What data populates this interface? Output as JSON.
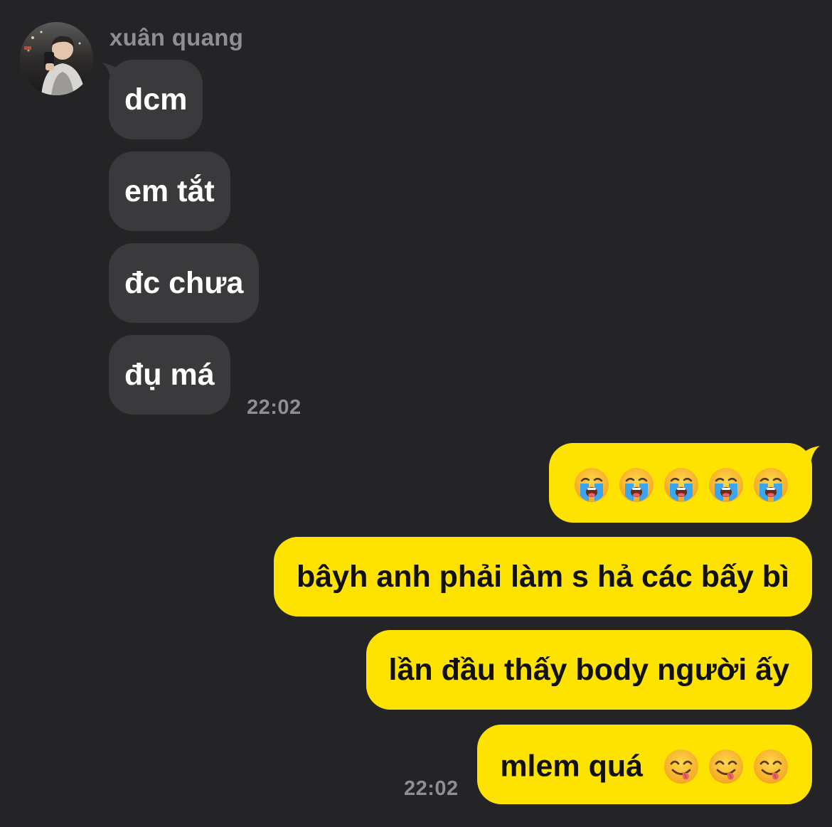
{
  "chat": {
    "sender_name": "xuân quang",
    "incoming_messages": [
      "dcm",
      "em tắt",
      "đc chưa",
      "đụ má"
    ],
    "incoming_time": "22:02",
    "outgoing_messages": [
      "bâyh anh phải làm s hả các bấy bì",
      "lần đầu thấy body người ấy",
      "mlem quá"
    ],
    "outgoing_time": "22:02",
    "emoji_message": {
      "emoji": "loudly-crying-face",
      "count": 5
    },
    "last_message_emoji": {
      "emoji": "face-savoring-food",
      "count": 3
    }
  },
  "colors": {
    "background": "#242426",
    "incoming_bubble": "#3a3a3c",
    "outgoing_bubble": "#ffe300",
    "meta_text": "#8e8e93"
  }
}
